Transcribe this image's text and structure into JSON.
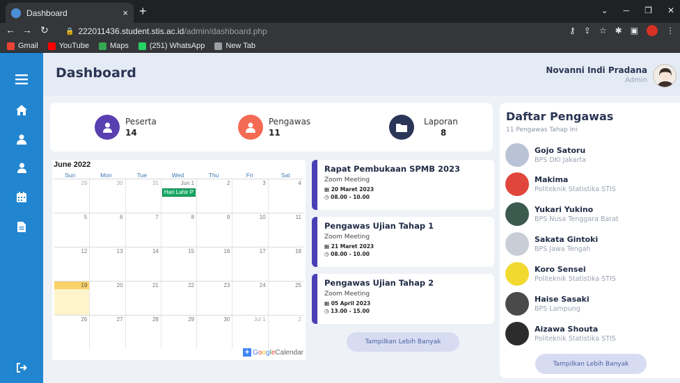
{
  "browser": {
    "tab_title": "Dashboard",
    "tab_close": "×",
    "new_tab": "+",
    "url_host": "222011436.student.stis.ac.id",
    "url_path": "/admin/dashboard.php",
    "bookmarks": [
      {
        "label": "Gmail",
        "color": "#ea4335"
      },
      {
        "label": "YouTube",
        "color": "#ff0000"
      },
      {
        "label": "Maps",
        "color": "#34a853"
      },
      {
        "label": "(251) WhatsApp",
        "color": "#25d366"
      },
      {
        "label": "New Tab",
        "color": "#9aa0a6"
      }
    ]
  },
  "header": {
    "title": "Dashboard",
    "user_name": "Novanni Indi Pradana",
    "user_role": "Admin"
  },
  "sidebar": {
    "icons": [
      "menu-icon",
      "home-icon",
      "users-icon",
      "user-icon",
      "calendar-icon",
      "document-icon",
      "logout-icon"
    ]
  },
  "stats": [
    {
      "label": "Peserta",
      "value": "14",
      "color": "#5a3fb0",
      "icon": "user-icon"
    },
    {
      "label": "Pengawas",
      "value": "11",
      "color": "#f46b54",
      "icon": "users-icon"
    },
    {
      "label": "Laporan",
      "value": "8",
      "color": "#2b3558",
      "icon": "folder-icon"
    }
  ],
  "calendar": {
    "month_title": "June 2022",
    "weekdays": [
      "Sun",
      "Mon",
      "Tue",
      "Wed",
      "Thu",
      "Fri",
      "Sat"
    ],
    "weeks": [
      [
        "29",
        "30",
        "31",
        "Jun 1",
        "2",
        "3",
        "4"
      ],
      [
        "5",
        "6",
        "7",
        "8",
        "9",
        "10",
        "11"
      ],
      [
        "12",
        "13",
        "14",
        "15",
        "16",
        "17",
        "18"
      ],
      [
        "19",
        "20",
        "21",
        "22",
        "23",
        "24",
        "25"
      ],
      [
        "26",
        "27",
        "28",
        "29",
        "30",
        "Jul 1",
        "2"
      ]
    ],
    "event_label": "Hari Lahir P",
    "brand": "Google",
    "brand_suffix": "Calendar",
    "plus": "+"
  },
  "events": [
    {
      "title": "Rapat Pembukaan SPMB 2023",
      "subtitle": "Zoom Meeting",
      "date": "20 Maret 2023",
      "time": "08.00 - 10.00"
    },
    {
      "title": "Pengawas Ujian Tahap 1",
      "subtitle": "Zoom Meeting",
      "date": "21 Maret 2023",
      "time": "08.00 - 10.00"
    },
    {
      "title": "Pengawas Ujian Tahap 2",
      "subtitle": "Zoom Meeting",
      "date": "05 April 2023",
      "time": "13.00 - 15.00"
    }
  ],
  "events_more_label": "Tampilkan Lebih Banyak",
  "pengawas": {
    "title": "Daftar Pengawas",
    "subtitle": "11 Pengawas Tahap Ini",
    "more_label": "Tampilkan Lebih Banyak",
    "items": [
      {
        "name": "Gojo Satoru",
        "org": "BPS DKI Jakarta",
        "color": "#b9c3d6"
      },
      {
        "name": "Makima",
        "org": "Politeknik Statistika STIS",
        "color": "#e0463c"
      },
      {
        "name": "Yukari Yukino",
        "org": "BPS Nusa Tenggara Barat",
        "color": "#3d5a4f"
      },
      {
        "name": "Sakata Gintoki",
        "org": "BPS Jawa Tengah",
        "color": "#c8cdd6"
      },
      {
        "name": "Koro Sensei",
        "org": "Politeknik Statistika STIS",
        "color": "#f1d930"
      },
      {
        "name": "Haise Sasaki",
        "org": "BPS Lampung",
        "color": "#4a4a4a"
      },
      {
        "name": "Aizawa Shouta",
        "org": "Politeknik Statistika STIS",
        "color": "#2c2c2c"
      }
    ]
  }
}
